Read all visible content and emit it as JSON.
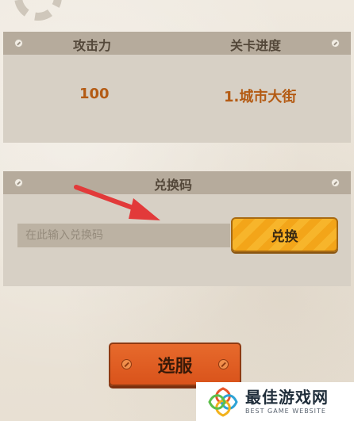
{
  "stats_panel": {
    "headers": {
      "attack": "攻击力",
      "progress": "关卡进度"
    },
    "values": {
      "attack": "100",
      "progress": "1.城市大街"
    }
  },
  "code_panel": {
    "title": "兑换码",
    "input_placeholder": "在此输入兑换码",
    "redeem_label": "兑换"
  },
  "server_button": {
    "label": "选服"
  },
  "watermark": {
    "title": "最佳游戏网",
    "subtitle": "BEST GAME WEBSITE"
  },
  "colors": {
    "panel_header": "#b6ab9c",
    "panel_body": "#d7d0c5",
    "value_text": "#b45b14",
    "redeem_button": "#f7b52b",
    "server_button": "#e2602a",
    "arrow": "#e23a3a"
  },
  "icons": [
    "gear-decoration",
    "bolt-icon",
    "red-arrow-icon",
    "watermark-logo-icon"
  ]
}
